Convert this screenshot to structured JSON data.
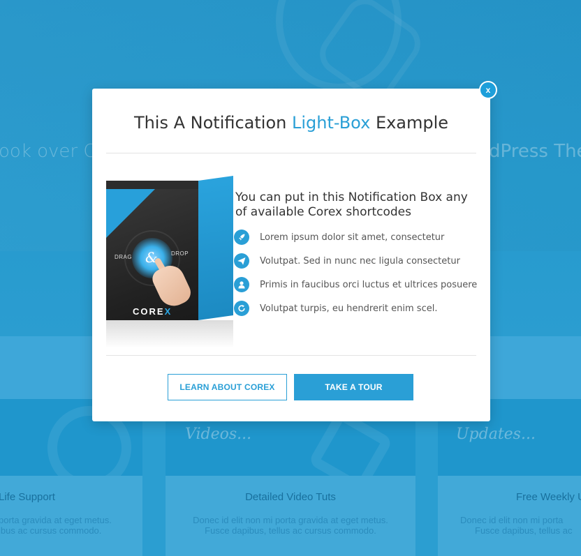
{
  "background": {
    "hero_left_text": "ook over Co",
    "hero_right_text": "dPress Them",
    "cards": [
      {
        "script": "",
        "title": "Life Support",
        "lines": [
          "porta gravida at eget metus.",
          "ibus ac cursus commodo."
        ]
      },
      {
        "script": "Videos...",
        "title": "Detailed Video Tuts",
        "lines": [
          "Donec id elit non mi porta gravida at eget metus.",
          "Fusce dapibus, tellus ac cursus commodo."
        ]
      },
      {
        "script": "Updates...",
        "title": "Free Weekly U",
        "lines": [
          "Donec id elit non mi porta",
          "Fusce dapibus, tellus ac"
        ]
      }
    ]
  },
  "modal": {
    "close_label": "x",
    "title_prefix": "This A Notification ",
    "title_accent": "Light-Box",
    "title_suffix": " Example",
    "product": {
      "drag_label": "DRAG",
      "drop_label": "DROP",
      "amp": "&",
      "brand_main": "CORE",
      "brand_accent": "X"
    },
    "info_heading": "You can put in this Notification Box any of available Corex  shortcodes",
    "features": [
      {
        "icon": "rocket-icon",
        "text": "Lorem ipsum dolor sit amet, consectetur"
      },
      {
        "icon": "paper-plane-icon",
        "text": "Volutpat. Sed in nunc nec ligula consectetur"
      },
      {
        "icon": "user-icon",
        "text": "Primis in faucibus orci luctus et ultrices posuere"
      },
      {
        "icon": "refresh-icon",
        "text": "Volutpat turpis, eu hendrerit enim scel."
      }
    ],
    "buttons": {
      "learn": "LEARN ABOUT COREX",
      "tour": "TAKE A TOUR"
    }
  },
  "colors": {
    "accent": "#2a9fd6",
    "background": "#2a9ccf"
  }
}
